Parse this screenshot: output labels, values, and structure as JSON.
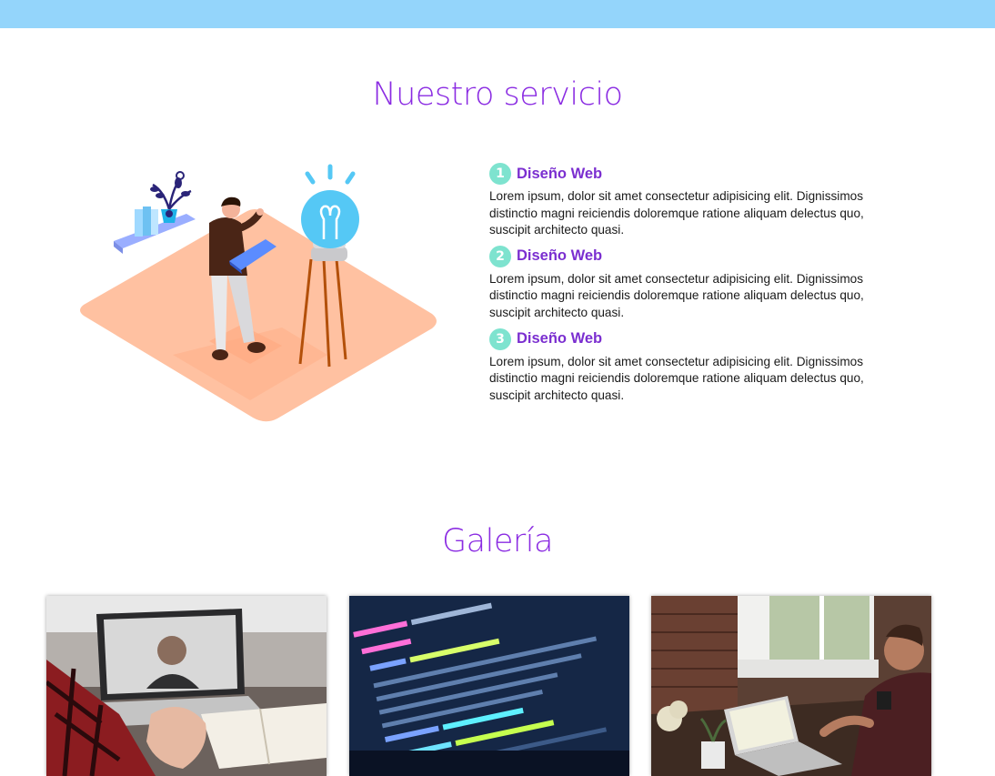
{
  "colors": {
    "top_bar": "#94d5fb",
    "accent_purple": "#8a2be2",
    "service_title": "#7b2fd0",
    "badge_mint": "#7ee3cf",
    "floor_peach": "#ffc1a1"
  },
  "services_section": {
    "title": "Nuestro servicio",
    "illustration_icon": "person-with-laptop-lightbulb-illustration",
    "items": [
      {
        "number": "1",
        "title": "Diseño Web",
        "text": "Lorem ipsum, dolor sit amet consectetur adipisicing elit. Dignissimos distinctio magni reiciendis doloremque ratione aliquam delectus quo, suscipit architecto quasi."
      },
      {
        "number": "2",
        "title": "Diseño Web",
        "text": "Lorem ipsum, dolor sit amet consectetur adipisicing elit. Dignissimos distinctio magni reiciendis doloremque ratione aliquam delectus quo, suscipit architecto quasi."
      },
      {
        "number": "3",
        "title": "Diseño Web",
        "text": "Lorem ipsum, dolor sit amet consectetur adipisicing elit. Dignissimos distinctio magni reiciendis doloremque ratione aliquam delectus quo, suscipit architecto quasi."
      }
    ]
  },
  "gallery_section": {
    "title": "Galería",
    "images": [
      {
        "icon": "video-call-laptop-photo"
      },
      {
        "icon": "code-screen-photo"
      },
      {
        "icon": "man-working-laptop-photo"
      }
    ]
  }
}
